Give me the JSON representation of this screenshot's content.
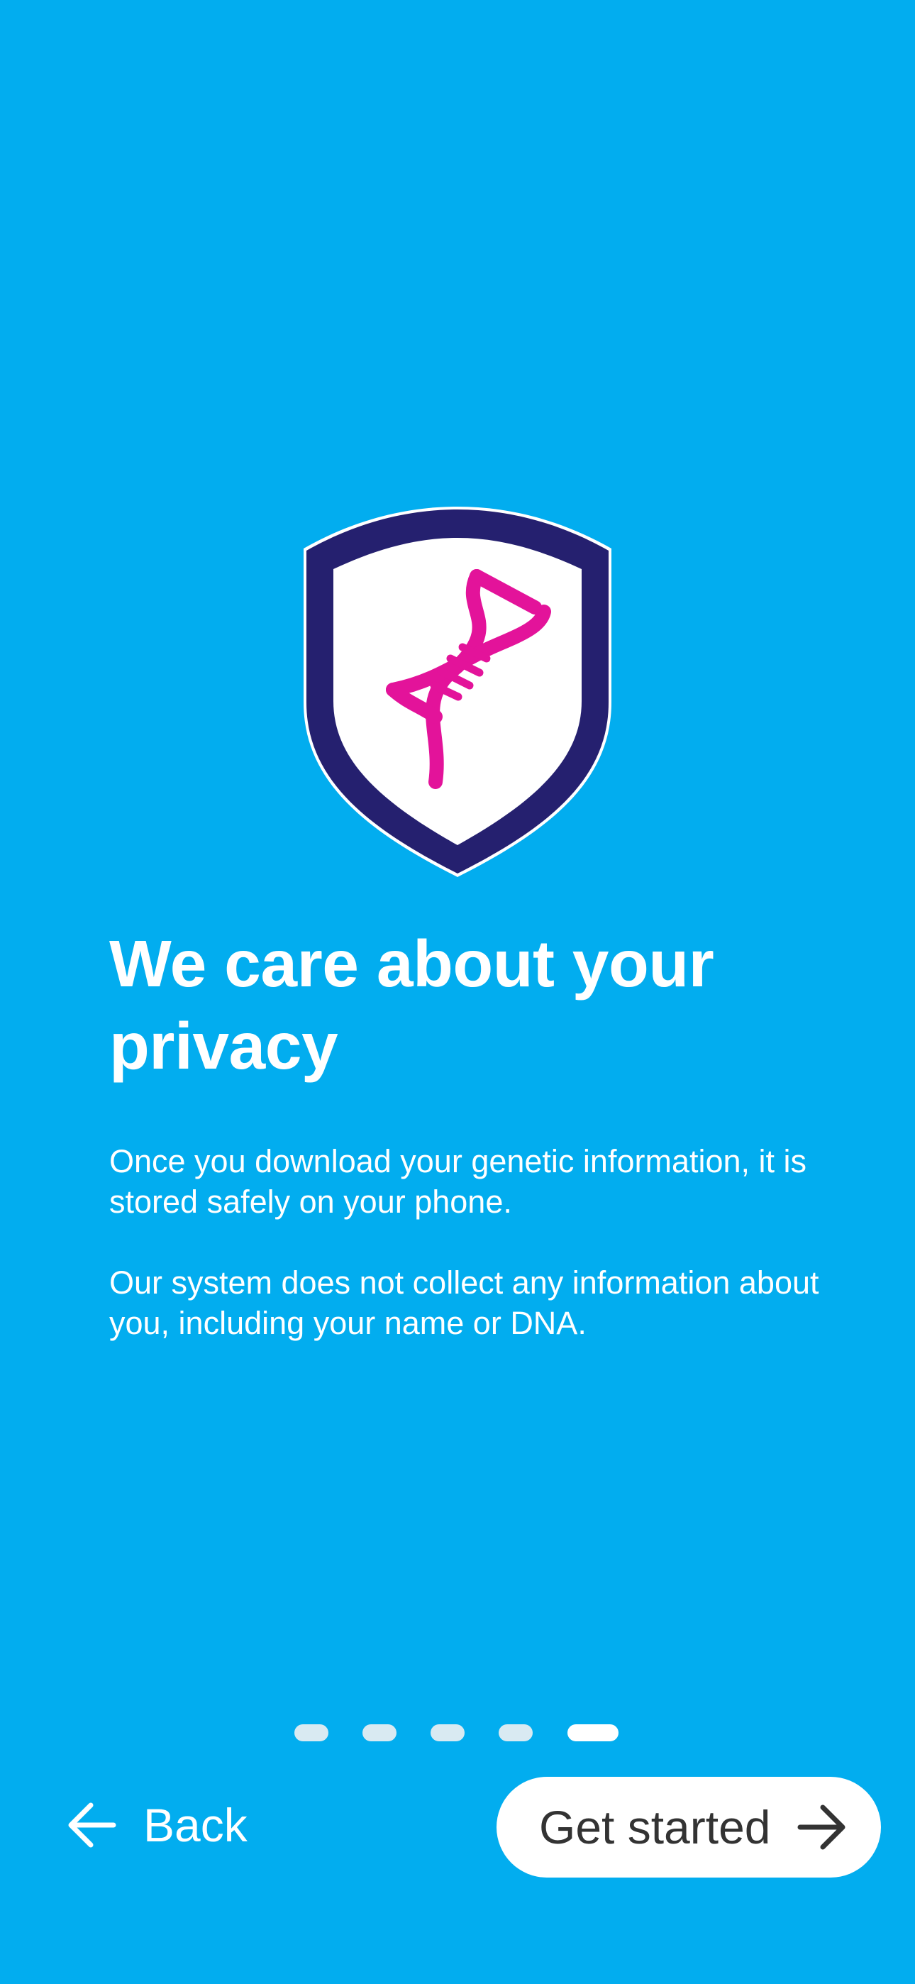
{
  "colors": {
    "background": "#02ADEF",
    "shield_outer": "#25206F",
    "shield_inner": "#FFFFFF",
    "dna": "#E3139A",
    "button_bg": "#FFFFFF",
    "button_text": "#333333",
    "pager_active": "#FFFFFF",
    "pager_inactive": "#D9EAF2"
  },
  "illustration": {
    "icon": "dna-shield-icon"
  },
  "onboarding": {
    "title": "We care about your privacy",
    "paragraph_1": "Once you download your genetic information, it is stored safely on your phone.",
    "paragraph_2": "Our system does not collect any information about you, including your name or DNA."
  },
  "pager": {
    "total_pages": 5,
    "current_page": 5
  },
  "navigation": {
    "back_label": "Back",
    "back_icon": "arrow-left-icon",
    "next_label": "Get started",
    "next_icon": "arrow-right-icon"
  }
}
